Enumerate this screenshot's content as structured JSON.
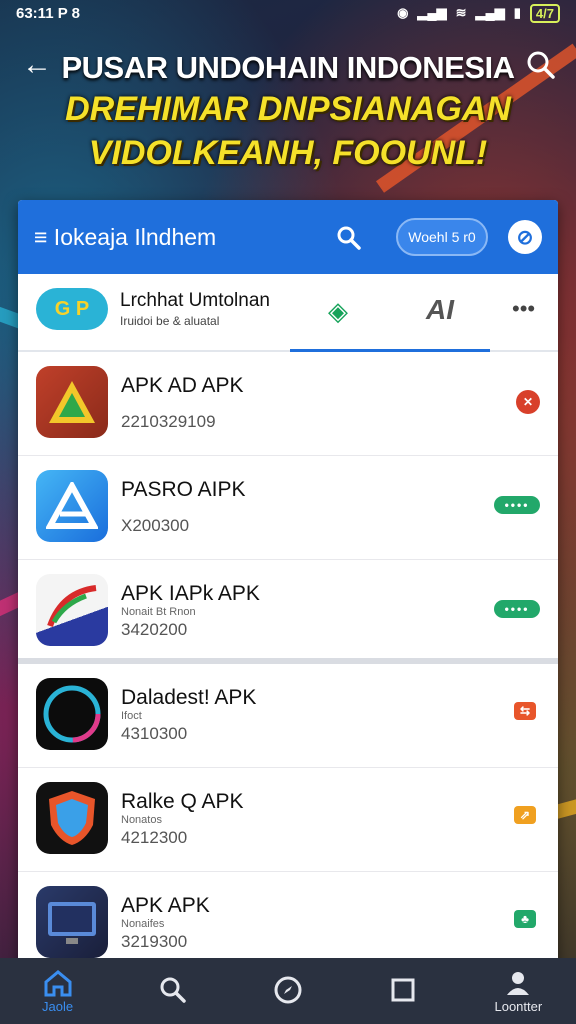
{
  "status_bar": {
    "time": "63:11 P 8",
    "battery": "4/7"
  },
  "headline": {
    "line1": "PUSAR UNDOHAIN INDONESIA",
    "line2": "DREHIMAR DNPSIANAGAN",
    "line3": "VIDOLKEANH, FOOUNL!"
  },
  "panel_header": {
    "title": "≡ Iokeaja Ilndhem",
    "pill_label": "Woehl 5 r0",
    "search_icon": "search-icon",
    "compass_icon": "compass-icon"
  },
  "tab_strip": {
    "logo_text": "G P",
    "title": "Lrchhat Umtolnan",
    "subtitle": "Iruidoi be & aluatal",
    "ai_label": "AI",
    "more": "•••"
  },
  "apps": [
    {
      "name": "APK AD APK",
      "sub": "",
      "number": "2210329109",
      "badge": "round",
      "badge_color": "#d8402a",
      "badge_text": "✕"
    },
    {
      "name": "PASRO AIPK",
      "sub": "",
      "number": "X200300",
      "badge": "pill",
      "badge_color": "#22a86a",
      "badge_text": "••••"
    },
    {
      "name": "APK IAPk APK",
      "sub": "Nonait Bt Rnon",
      "number": "3420200",
      "badge": "pill",
      "badge_color": "#22a86a",
      "badge_text": "••••"
    },
    {
      "name": "Daladest! APK",
      "sub": "Ifoct",
      "number": "4310300",
      "badge": "sq",
      "badge_color": "#e8552a",
      "badge_text": "⇆"
    },
    {
      "name": "Ralke Q APK",
      "sub": "Nonatos",
      "number": "4212300",
      "badge": "sq",
      "badge_color": "#f0a020",
      "badge_text": "⇗"
    },
    {
      "name": "APK APK",
      "sub": "Nonaifes",
      "number": "3219300",
      "badge": "sq",
      "badge_color": "#22a86a",
      "badge_text": "♣"
    }
  ],
  "bottom_nav": [
    {
      "label": "Jaole",
      "icon": "home-icon"
    },
    {
      "label": "",
      "icon": "search-icon"
    },
    {
      "label": "",
      "icon": "compass-icon"
    },
    {
      "label": "",
      "icon": "square-icon"
    },
    {
      "label": "Loontter",
      "icon": "user-icon"
    }
  ],
  "colors": {
    "accent": "#1f6fdc",
    "headline_yellow": "#f5e12a",
    "nav_bg": "#2a3140"
  }
}
